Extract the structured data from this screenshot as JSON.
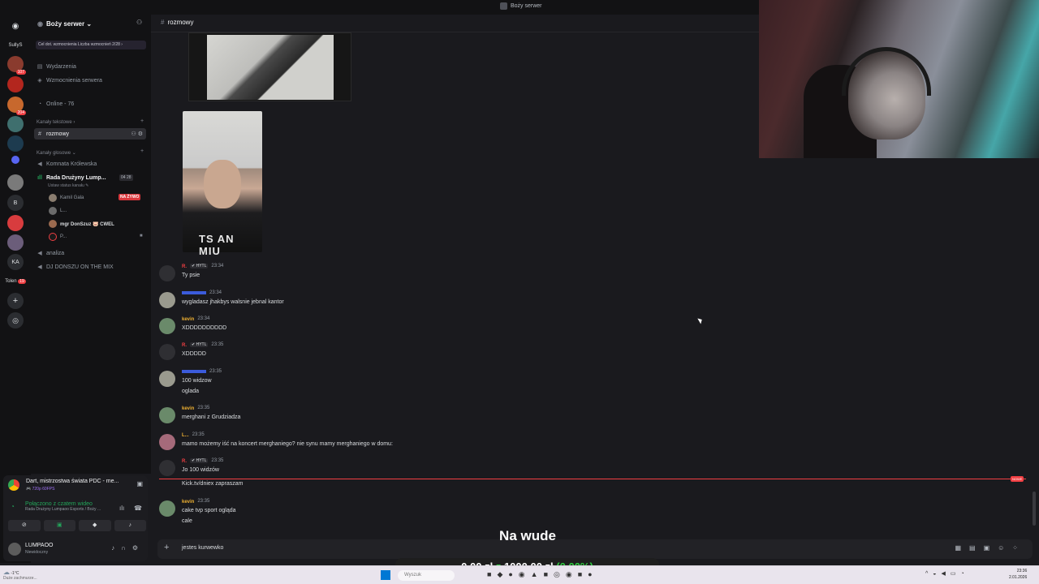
{
  "window": {
    "title": "Boży serwer"
  },
  "rail": {
    "items": [
      {
        "label": "SullyS"
      },
      {
        "label": "B"
      },
      {
        "label": "KA"
      },
      {
        "label": "Tolen"
      }
    ],
    "badges": [
      "107",
      "204",
      "19"
    ]
  },
  "server": {
    "name": "Boży serwer ⌄",
    "boost_text": "Cel dot. wzmocnienia  Liczba wzmocnień 2/28 ›",
    "menu": [
      "Wydarzenia",
      "Wzmocnienia serwera",
      "Online - 76"
    ],
    "text_category": "Kanały tekstowe ›",
    "active_channel": "rozmowy",
    "voice_category": "Kanały głosowe ⌄",
    "voice_channels": [
      "Komnata Królewska",
      "Rada Drużyny Lump...",
      "analiza",
      "DJ DONSZU ON THE MIX"
    ],
    "voice_status": "Ustaw status kanału ✎",
    "voice_counts": "04  28",
    "voice_users": [
      "Kamil Gala",
      "L...",
      "mgr DonSzuz 🐷 CWEL",
      "P..."
    ],
    "live_badge": "NA ŻYWO"
  },
  "panel": {
    "activity_title": "Dart, mistrzostwa świata PDC - me...",
    "activity_sub": "🎮 720p 60FPS",
    "voice_connected": "Połączono z czatem wideo",
    "voice_where": "Rada Drużyny Lumpaoo Esports / Boży ...",
    "username": "LUMPAOO",
    "user_status": "Niewidoczny"
  },
  "chat": {
    "channel": "rozmowy",
    "image_shirt_text": "TS AN\nMIU",
    "messages": [
      {
        "name": "R.",
        "name_color": "#f23f43",
        "tag": "✔ HYTL",
        "time": "23:34",
        "lines": [
          "Ty psie"
        ]
      },
      {
        "name": "",
        "name_color": "#3b5bdb",
        "tag": "",
        "time": "23:34",
        "lines": [
          "wygladasz jhakbys walsnie jebnal kantor"
        ]
      },
      {
        "name": "kevin",
        "name_color": "#f0b232",
        "tag": "",
        "time": "23:34",
        "lines": [
          "XDDDDDDDDDD"
        ]
      },
      {
        "name": "R.",
        "name_color": "#f23f43",
        "tag": "✔ HYTL",
        "time": "23:35",
        "lines": [
          "XDDDDD"
        ]
      },
      {
        "name": "",
        "name_color": "#3b5bdb",
        "tag": "",
        "time": "23:35",
        "lines": [
          "100 widzow",
          "oglada"
        ]
      },
      {
        "name": "kevin",
        "name_color": "#f0b232",
        "tag": "",
        "time": "23:35",
        "lines": [
          "merghani z Grudziadza"
        ]
      },
      {
        "name": "L...",
        "name_color": "#f0b232",
        "tag": "",
        "time": "23:35",
        "lines": [
          "mamo możemy iść na koncert merghaniego? nie synu mamy merghaniego w domu:"
        ]
      },
      {
        "name": "R.",
        "name_color": "#f23f43",
        "tag": "✔ HYTL",
        "time": "23:35",
        "lines": [
          "Jo 100 widzów"
        ]
      },
      {
        "name": "",
        "name_color": "#dbdee1",
        "tag": "",
        "time": "",
        "lines": [
          "Kick.tv/dniex zapraszam"
        ]
      },
      {
        "name": "kevin",
        "name_color": "#f0b232",
        "tag": "",
        "time": "23:35",
        "lines": [
          "cake tvp sport ogląda",
          "cale"
        ]
      }
    ],
    "new_tag": "NOWE",
    "composer_value": "jestes kurwewko"
  },
  "overlay": {
    "caption": "Na wude",
    "bet_left": "0,00 zł",
    "bet_mid": "z",
    "bet_right": "1000,00 zł",
    "bet_pct": "(0.00%)"
  },
  "taskbar": {
    "weather": "-1°C",
    "weather_sub": "Duże zachmurze...",
    "search": "Wyszuk",
    "time": "23:36",
    "date": "2.01.2026"
  }
}
